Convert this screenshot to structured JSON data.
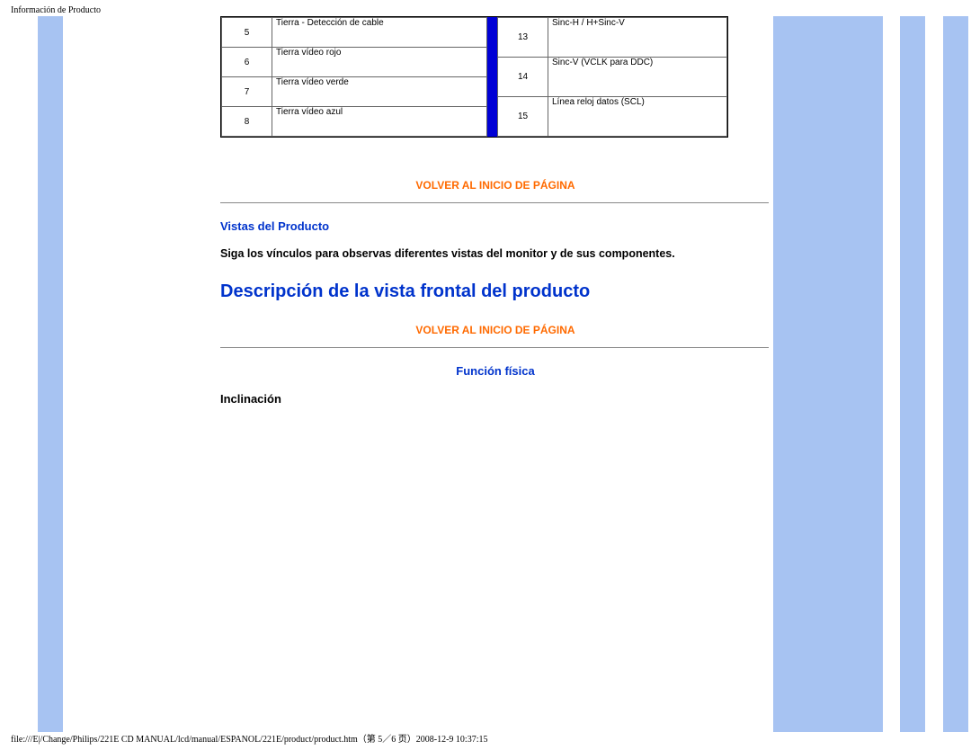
{
  "header": "Información de Producto",
  "footer": "file:///E|/Change/Philips/221E CD MANUAL/lcd/manual/ESPANOL/221E/product/product.htm（第 5／6 页）2008-12-9 10:37:15",
  "pins_left": [
    {
      "n": "5",
      "d": "Tierra - Detección de cable"
    },
    {
      "n": "6",
      "d": "Tierra vídeo rojo"
    },
    {
      "n": "7",
      "d": "Tierra vídeo verde"
    },
    {
      "n": "8",
      "d": "Tierra vídeo azul"
    }
  ],
  "pins_right": [
    {
      "n": "13",
      "d": "Sinc-H / H+Sinc-V"
    },
    {
      "n": "14",
      "d": "Sinc-V (VCLK para DDC)"
    },
    {
      "n": "15",
      "d": "Línea reloj datos (SCL)"
    }
  ],
  "back_top": "VOLVER AL INICIO DE PÁGINA",
  "views_title": "Vistas del Producto",
  "views_body": "Siga los vínculos para observas diferentes vistas del monitor y de sus componentes.",
  "big_link": "Descripción de la vista frontal del producto",
  "func_title": "Función física",
  "tilt_label": "Inclinación"
}
